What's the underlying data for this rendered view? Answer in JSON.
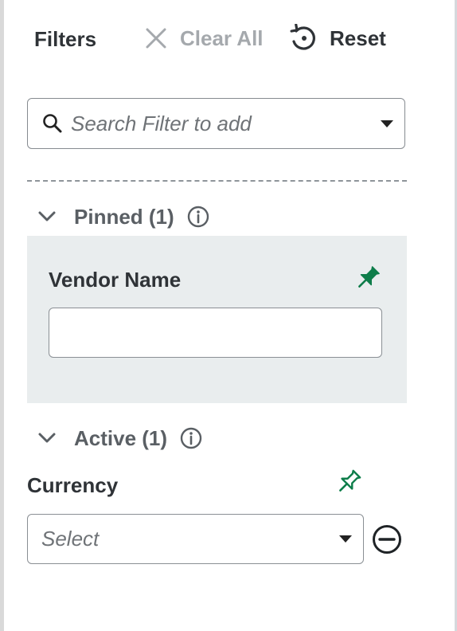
{
  "header": {
    "title": "Filters",
    "clear_all_label": "Clear All",
    "reset_label": "Reset"
  },
  "search": {
    "placeholder": "Search Filter to add"
  },
  "sections": {
    "pinned": {
      "label": "Pinned (1)"
    },
    "active": {
      "label": "Active (1)"
    }
  },
  "filters": {
    "vendor_name": {
      "label": "Vendor Name",
      "value": "",
      "pinned": true
    },
    "currency": {
      "label": "Currency",
      "placeholder": "Select",
      "pinned": false
    }
  },
  "colors": {
    "accent_green": "#0e7d4a",
    "disabled_gray": "#a5a9ad",
    "pinned_bg": "#e9edee"
  },
  "icons": [
    "close-icon",
    "reset-icon",
    "search-icon",
    "chevron-down-icon",
    "info-icon",
    "pin-filled-icon",
    "pin-outline-icon",
    "minus-circle-icon"
  ]
}
